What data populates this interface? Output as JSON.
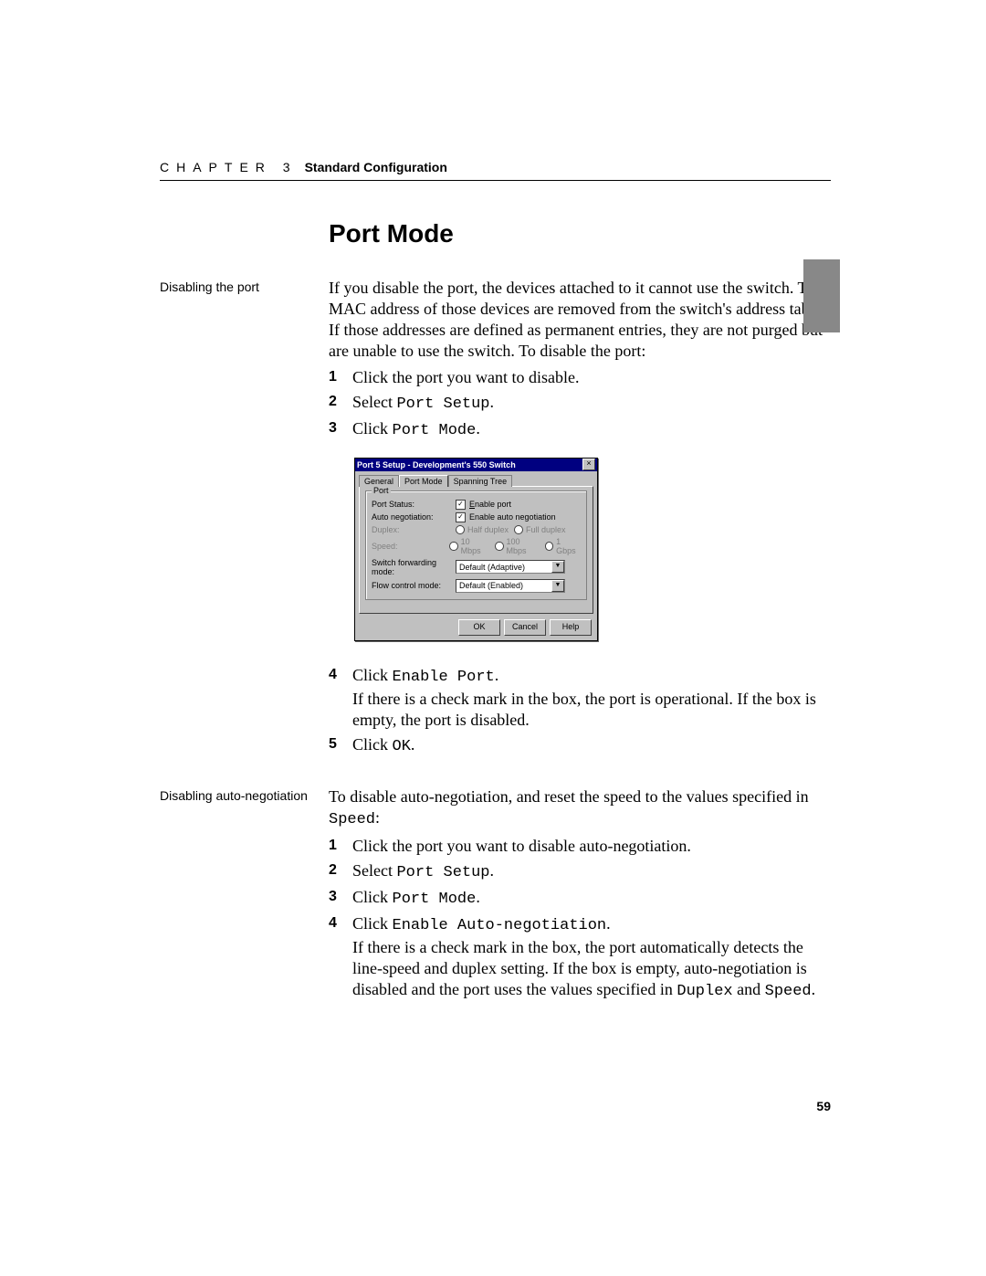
{
  "header": {
    "chapter_spaced": "CHAPTER 3",
    "chapter_title": "Standard Configuration"
  },
  "heading": "Port Mode",
  "section1": {
    "side": "Disabling the port",
    "intro": "If you disable the port, the devices attached to it cannot use the switch. The MAC address of those devices are removed from the switch's address table. If those addresses are defined as permanent entries, they are not purged but are unable to use the switch. To disable the port:",
    "steps": {
      "s1": "Click the port you want to disable.",
      "s2a": "Select ",
      "s2b": "Port Setup",
      "s2c": ".",
      "s3a": "Click ",
      "s3b": "Port Mode",
      "s3c": ".",
      "s4a": "Click ",
      "s4b": "Enable Port",
      "s4c": ".",
      "s4_sub": "If there is a check mark in the box, the port is operational. If the box is empty, the port is disabled.",
      "s5a": "Click ",
      "s5b": "OK",
      "s5c": "."
    }
  },
  "section2": {
    "side": "Disabling auto-negotiation",
    "intro_a": "To disable auto-negotiation, and reset the speed to the values specified in ",
    "intro_b": "Speed",
    "intro_c": ":",
    "steps": {
      "s1": "Click the port you want to disable auto-negotiation.",
      "s2a": "Select ",
      "s2b": "Port Setup",
      "s2c": ".",
      "s3a": "Click ",
      "s3b": "Port Mode",
      "s3c": ".",
      "s4a": "Click ",
      "s4b": "Enable Auto-negotiation",
      "s4c": ".",
      "s4_sub_a": "If there is a check mark in the box, the port automatically detects the line-speed and duplex setting. If the box is empty, auto-negotiation is disabled and the port uses the values specified in ",
      "s4_sub_b": "Duplex",
      "s4_sub_c": " and ",
      "s4_sub_d": "Speed",
      "s4_sub_e": "."
    }
  },
  "dialog": {
    "title": "Port 5 Setup - Development's 550 Switch",
    "tabs": {
      "general": "General",
      "portmode": "Port Mode",
      "spanning": "Spanning Tree"
    },
    "group": "Port",
    "labels": {
      "status": "Port Status:",
      "auto": "Auto negotiation:",
      "duplex": "Duplex:",
      "speed": "Speed:",
      "fwd": "Switch forwarding mode:",
      "flow": "Flow control mode:"
    },
    "values": {
      "enable_port": "Enable port",
      "enable_auto": "Enable auto negotiation",
      "half": "Half duplex",
      "full": "Full duplex",
      "s10": "10 Mbps",
      "s100": "100 Mbps",
      "s1g": "1 Gbps",
      "fwd_sel": "Default (Adaptive)",
      "flow_sel": "Default (Enabled)"
    },
    "buttons": {
      "ok": "OK",
      "cancel": "Cancel",
      "help": "Help"
    }
  },
  "page_num": "59"
}
